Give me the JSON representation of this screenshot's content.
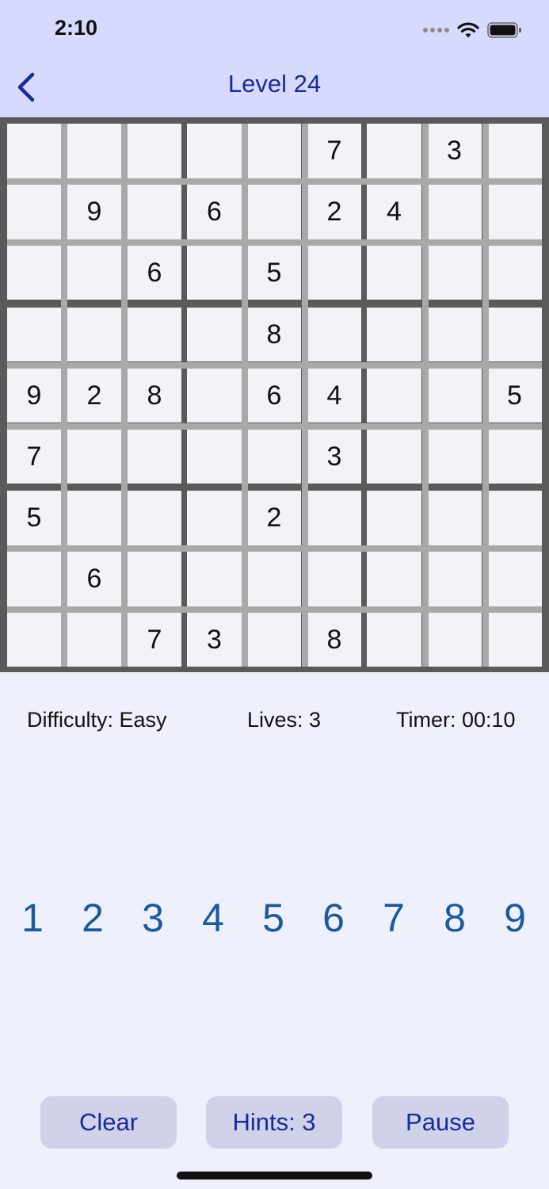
{
  "status_bar": {
    "time": "2:10"
  },
  "nav": {
    "title": "Level 24",
    "back_icon": "chevron-left-icon"
  },
  "board": {
    "cells": [
      [
        "",
        "",
        "",
        "",
        "",
        "7",
        "",
        "3",
        ""
      ],
      [
        "",
        "9",
        "",
        "6",
        "",
        "2",
        "4",
        "",
        ""
      ],
      [
        "",
        "",
        "6",
        "",
        "5",
        "",
        "",
        "",
        ""
      ],
      [
        "",
        "",
        "",
        "",
        "8",
        "",
        "",
        "",
        ""
      ],
      [
        "9",
        "2",
        "8",
        "",
        "6",
        "4",
        "",
        "",
        "5"
      ],
      [
        "7",
        "",
        "",
        "",
        "",
        "3",
        "",
        "",
        ""
      ],
      [
        "5",
        "",
        "",
        "",
        "2",
        "",
        "",
        "",
        ""
      ],
      [
        "",
        "6",
        "",
        "",
        "",
        "",
        "",
        "",
        ""
      ],
      [
        "",
        "",
        "7",
        "3",
        "",
        "8",
        "",
        "",
        ""
      ]
    ]
  },
  "info": {
    "difficulty": "Difficulty: Easy",
    "lives": "Lives: 3",
    "timer": "Timer: 00:10"
  },
  "numpad": {
    "keys": [
      "1",
      "2",
      "3",
      "4",
      "5",
      "6",
      "7",
      "8",
      "9"
    ]
  },
  "actions": {
    "clear_label": "Clear",
    "hints_label": "Hints: 3",
    "pause_label": "Pause"
  },
  "colors": {
    "header_bg": "#d7dafc",
    "page_bg": "#eef0fc",
    "accent": "#1a2a99",
    "numpad": "#1a5a9e",
    "cell_bg": "#f3f3f7",
    "button_bg": "#cfd2e8"
  }
}
